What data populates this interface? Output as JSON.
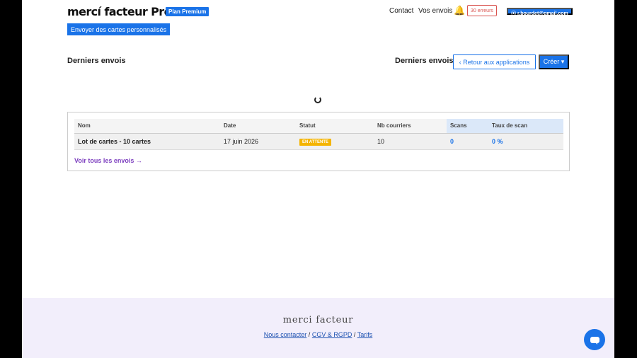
{
  "header": {
    "logo": "mercí facteur Pro",
    "plan_badge": "Plan Premium",
    "send_cards": "Envoyer des cartes personnalisés",
    "nav_contact": "Contact",
    "nav_envois": "Vos envois",
    "bell_icon": "🔔",
    "errors": "30 erreurs",
    "user": "⦿ r.bourdet@gmail.com"
  },
  "main": {
    "title_left": "Derniers envois",
    "title_right": "Derniers envois",
    "back_button": "‹ Retour aux applications",
    "create_button": "Créer ▾"
  },
  "table": {
    "headers": [
      "Nom",
      "Date",
      "Statut",
      "Nb courriers",
      "Scans",
      "Taux de scan"
    ],
    "rows": [
      {
        "nom": "Lot de cartes - 10 cartes",
        "date": "17 juin 2026",
        "statut": "EN ATTENTE",
        "nb_courriers": "10",
        "scans": "0",
        "taux_scan": "0 %"
      }
    ],
    "see_all": "Voir tous les envois →"
  },
  "footer": {
    "brand": "merci facteur",
    "links": [
      "Nous contacter",
      "CGV & RGPD",
      "Tarifs"
    ],
    "separator": "/"
  },
  "colors": {
    "accent": "#1a73e8",
    "status_pending": "#f4b400",
    "link_purple": "#7d3fbf",
    "footer_bg": "#f2eefb"
  }
}
